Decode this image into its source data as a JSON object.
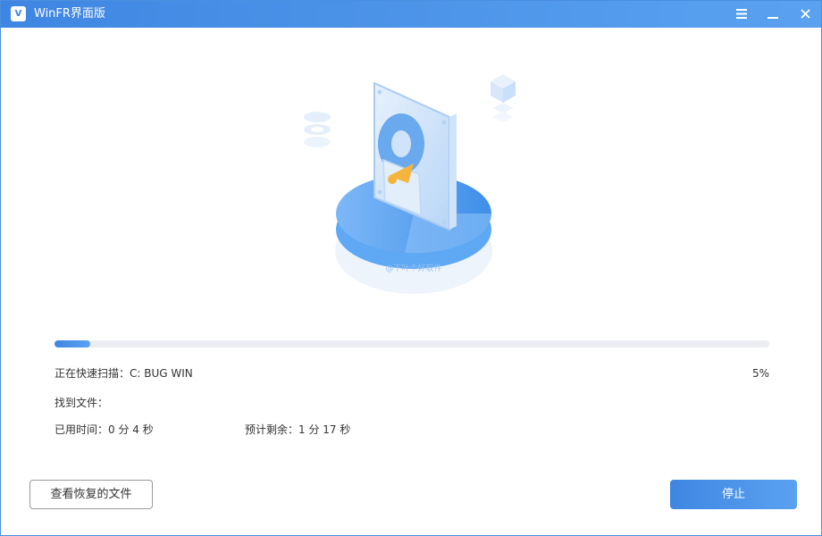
{
  "titlebar": {
    "title": "WinFR界面版",
    "logo_text": "V"
  },
  "hero": {
    "watermark": "@下叶个好软件"
  },
  "scan": {
    "progress_percent": 5,
    "status_label": "正在快速扫描：",
    "drive": "C: BUG WIN",
    "percent_text": "5%",
    "found_label": "找到文件：",
    "elapsed_label": "已用时间：",
    "elapsed_value": "0 分 4 秒",
    "remaining_label": "预计剩余：",
    "remaining_value": "1 分 17 秒"
  },
  "actions": {
    "view_recovered": "查看恢复的文件",
    "stop": "停止"
  },
  "colors": {
    "accent": "#3f86e2",
    "accent_light": "#5aa2f0",
    "track": "#ebedf2"
  }
}
